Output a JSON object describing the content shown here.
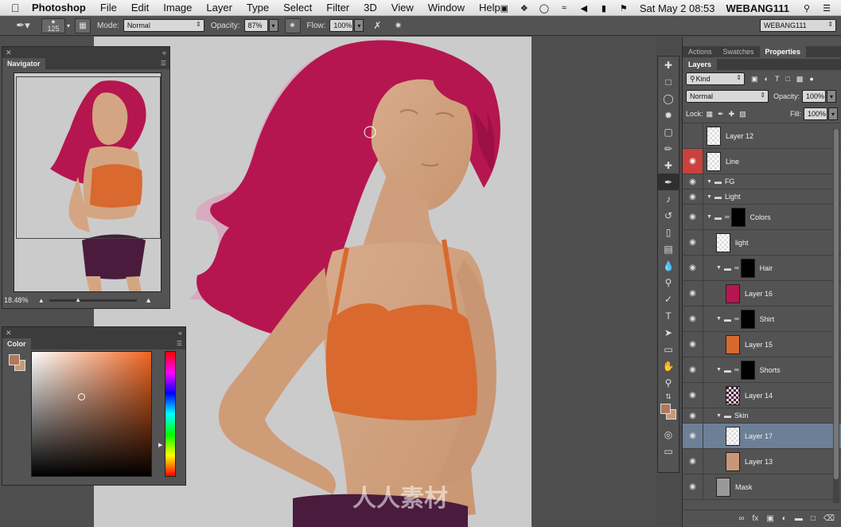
{
  "menubar": {
    "app": "Photoshop",
    "menus": [
      "File",
      "Edit",
      "Image",
      "Layer",
      "Type",
      "Select",
      "Filter",
      "3D",
      "View",
      "Window",
      "Help"
    ],
    "clock": "Sat May 2  08:53",
    "user": "WEBANG111"
  },
  "options": {
    "brush_size": "125",
    "mode_label": "Mode:",
    "mode_value": "Normal",
    "opacity_label": "Opacity:",
    "opacity_value": "87%",
    "flow_label": "Flow:",
    "flow_value": "100%",
    "workspace": "WEBANG111"
  },
  "navigator": {
    "title": "Navigator",
    "zoom": "18.48%"
  },
  "color_panel": {
    "title": "Color",
    "foreground": "#b0785a",
    "background": "#c69a7a"
  },
  "right_tabs": [
    "Actions",
    "Swatches",
    "Properties"
  ],
  "layers_panel": {
    "title": "Layers",
    "kind": "Kind",
    "blend": "Normal",
    "opacity_label": "Opacity:",
    "opacity": "100%",
    "lock_label": "Lock:",
    "fill_label": "Fill:",
    "fill": "100%",
    "layers": [
      {
        "name": "Layer 12"
      },
      {
        "name": "Line"
      },
      {
        "name": "FG"
      },
      {
        "name": "Light"
      },
      {
        "name": "Colors"
      },
      {
        "name": "light"
      },
      {
        "name": "Hair"
      },
      {
        "name": "Layer 16"
      },
      {
        "name": "Shirt"
      },
      {
        "name": "Layer 15"
      },
      {
        "name": "Shorts"
      },
      {
        "name": "Layer 14"
      },
      {
        "name": "Skin"
      },
      {
        "name": "Layer 17"
      },
      {
        "name": "Layer 13"
      },
      {
        "name": "Mask"
      }
    ]
  },
  "colors": {
    "hair": "#b5164f",
    "skin": "#d4a582",
    "top": "#d9692e",
    "shorts": "#4a1b3d",
    "selected": "#6d7f97"
  }
}
